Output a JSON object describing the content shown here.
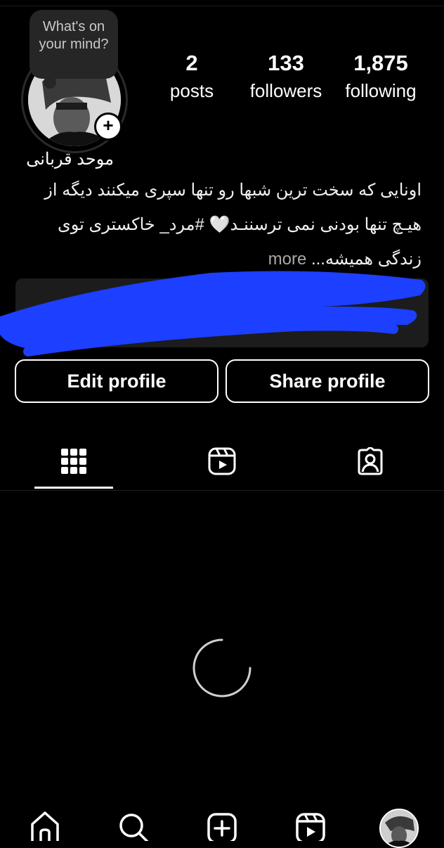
{
  "note": {
    "text": "What's on your mind?"
  },
  "stats": {
    "posts": {
      "value": "2",
      "label": "posts"
    },
    "followers": {
      "value": "133",
      "label": "followers"
    },
    "following": {
      "value": "1,875",
      "label": "following"
    }
  },
  "profile": {
    "name": "موحد قربانی",
    "bio_text": "اونایی که سخت ترین شبها رو تنها سپری میکنند  دیگه از هیـچ تنها بودنی نمی ترسننـد🤍 #مرد_ خاکستری توی زندگی همیشه...",
    "more_label": "more"
  },
  "buttons": {
    "edit": "Edit profile",
    "share": "Share profile"
  },
  "tabs": [
    {
      "icon": "grid-icon",
      "active": true
    },
    {
      "icon": "reels-icon",
      "active": false
    },
    {
      "icon": "tagged-icon",
      "active": false
    }
  ],
  "nav": [
    "home-icon",
    "search-icon",
    "create-icon",
    "reels-icon",
    "profile-avatar"
  ],
  "colors": {
    "background": "#000000",
    "text": "#ffffff",
    "muted": "#a8a8a8",
    "scribble": "#1d3fff"
  }
}
